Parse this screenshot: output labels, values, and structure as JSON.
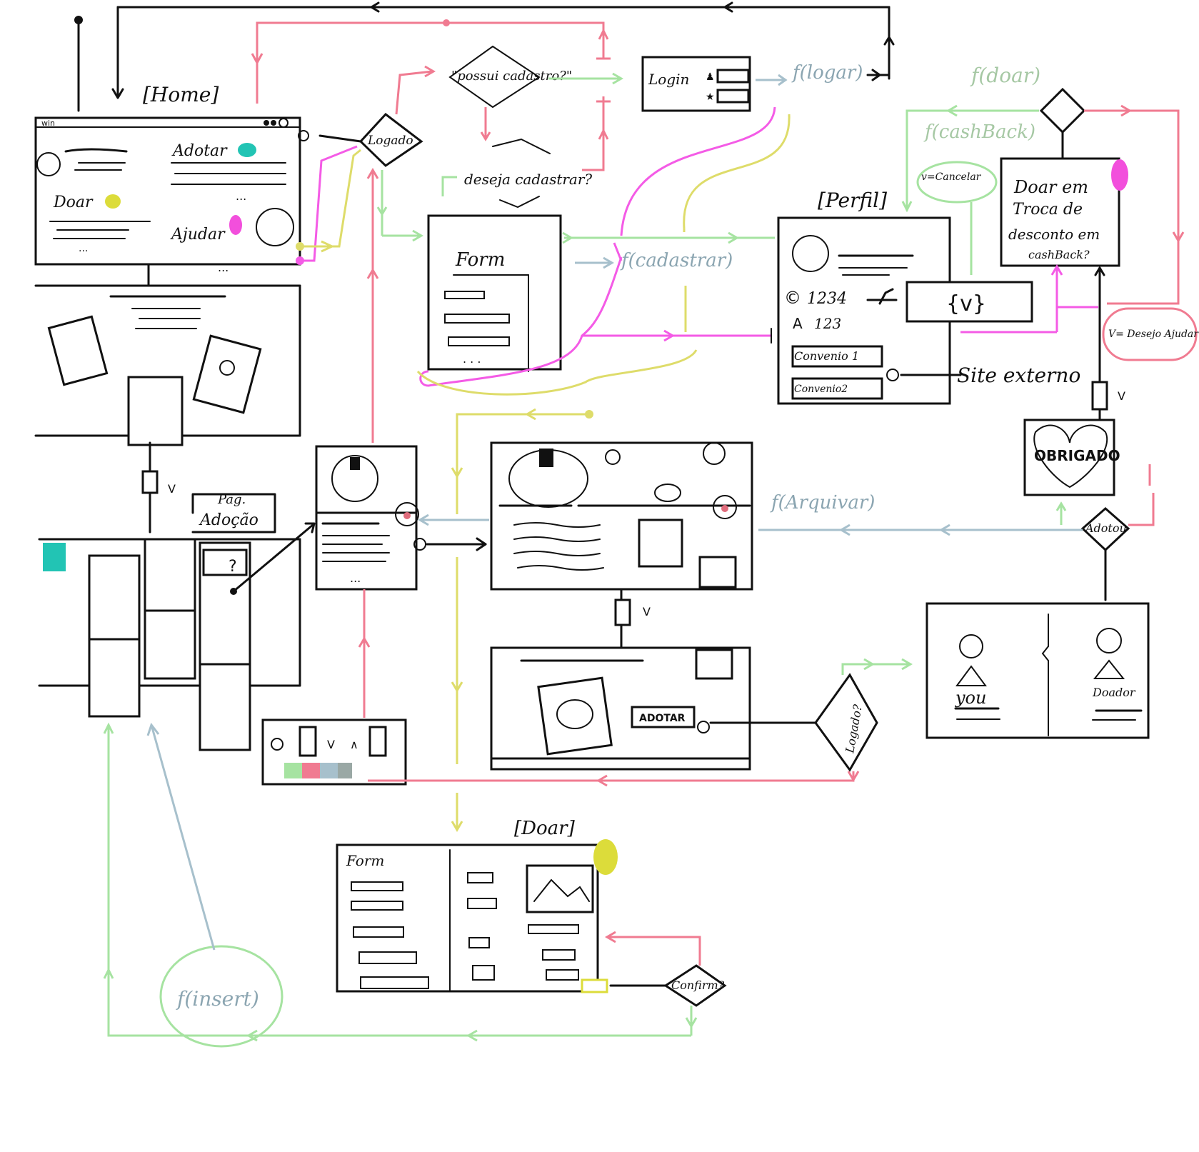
{
  "colors": {
    "ink": "#111111",
    "red_flow": "#f07b91",
    "green_flow": "#a6e3a1",
    "blue_flow": "#a7c0cc",
    "magenta_flow": "#f45be6",
    "yellow_flow": "#dedc6a",
    "teal_marker": "#22c4b4",
    "pink_marker": "#f24fdc",
    "yellow_marker": "#dcdc3a"
  },
  "labels": {
    "home": "[Home]",
    "win": "win",
    "adotar": "Adotar",
    "doar": "Doar",
    "ajudar": "Ajudar",
    "logado": "Logado",
    "logado_q": "Logado?",
    "possui_cadastro": "\"possui cadastro?\"",
    "deseja_cadastrar": "deseja cadastrar?",
    "login": "Login",
    "f_logar": "f(logar)",
    "f_cadastrar": "f(cadastrar)",
    "form": "Form",
    "perfil": "[Perfil]",
    "f_doar": "f(doar)",
    "f_cashback": "f(cashBack)",
    "v_cancelar": "v=Cancelar",
    "doar_troca": [
      "Doar em",
      "Troca de",
      "desconto em",
      "cashBack?"
    ],
    "v_set": "{v}",
    "saldo_1": "1234",
    "saldo_2": "123",
    "convenio_1": "Convenio 1",
    "convenio_2": "Convenio2",
    "site_externo": "Site externo",
    "v_desejo_ajudar": "V= Desejo Ajudar",
    "v": "V",
    "obrigado": "OBRIGADO",
    "pag_adocao": [
      "Pag.",
      "Adoção"
    ],
    "f_arquivar": "f(Arquivar)",
    "adotou": "Adotou",
    "btn_adotar": "ADOTAR",
    "you": "you",
    "doador": "Doador",
    "doar_page": "[Doar]",
    "form_doar": "Form",
    "confirm": "Confirm?",
    "f_insert": "f(insert)",
    "q_mark": "?",
    "c_symbol": "©",
    "a_symbol": "A"
  }
}
